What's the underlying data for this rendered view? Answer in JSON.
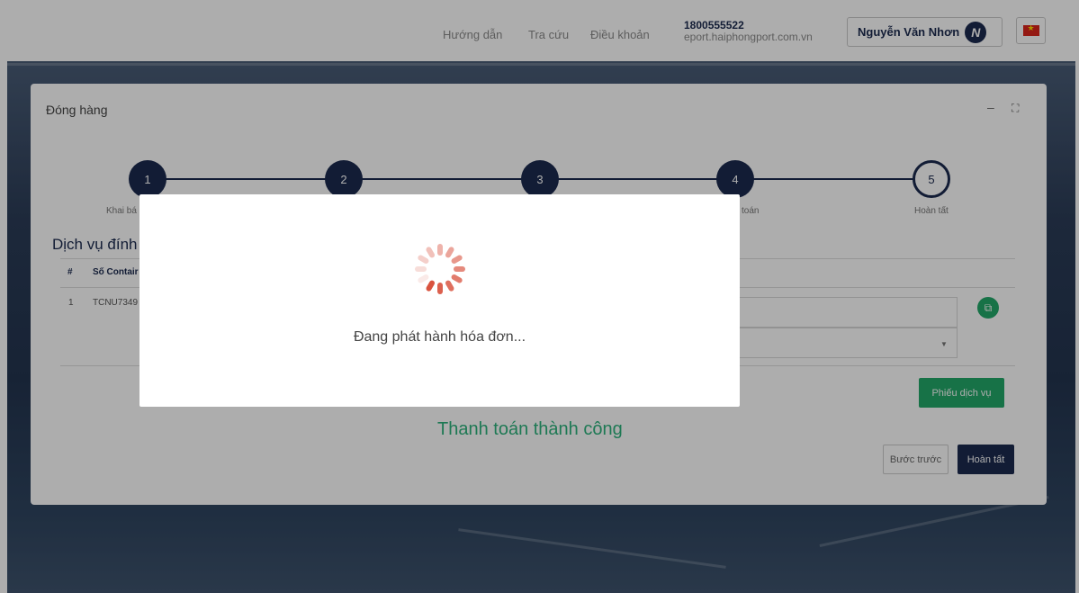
{
  "header": {
    "nav": [
      "Hướng dẫn",
      "Tra cứu",
      "Điều khoản"
    ],
    "hotline": "1800555522",
    "website": "eport.haiphongport.com.vn",
    "user_name": "Nguyễn Văn Nhơn",
    "avatar_initial": "N",
    "language_flag": "vn-flag-icon"
  },
  "card": {
    "title": "Đóng hàng",
    "minimize_icon": "minimize-icon",
    "expand_icon": "expand-icon",
    "steps": [
      {
        "number": "1",
        "label": "Khai bá"
      },
      {
        "number": "2",
        "label": ""
      },
      {
        "number": "3",
        "label": ""
      },
      {
        "number": "4",
        "label": "toán"
      },
      {
        "number": "5",
        "label": "Hoàn tất"
      }
    ],
    "section_title": "Dịch vụ đính",
    "table": {
      "headers": [
        "#",
        "Số Contair"
      ],
      "rows": [
        {
          "index": "1",
          "container": "TCNU7349"
        }
      ]
    },
    "service_slip_button": "Phiếu dịch vụ",
    "success_text": "Thanh toán thành công",
    "back_button": "Bước trước",
    "finish_button": "Hoàn tất"
  },
  "modal": {
    "message": "Đang phát hành hóa đơn..."
  },
  "colors": {
    "navy": "#1b2a4e",
    "green": "#22a869",
    "success": "#2db37d",
    "spinner": "#d9533f"
  }
}
